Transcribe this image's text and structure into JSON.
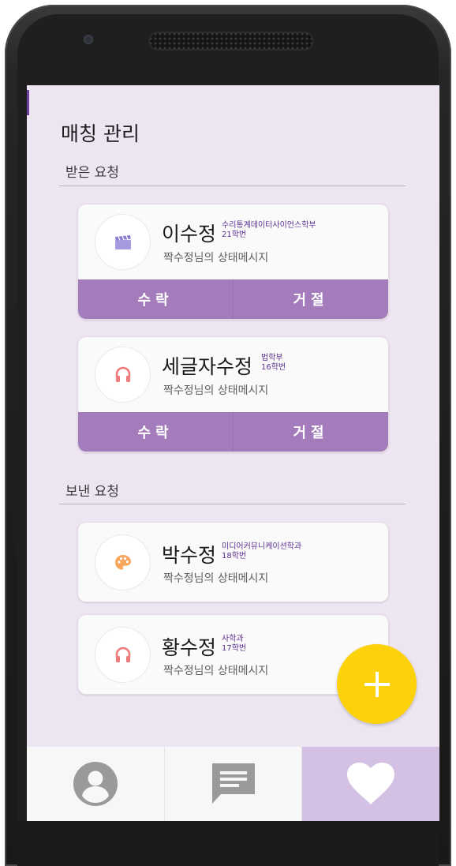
{
  "header": {
    "title": "매칭 관리"
  },
  "received": {
    "label": "받은 요청",
    "cards": [
      {
        "name": "이수정",
        "dept": "수리통계데이터사이언스학부",
        "year": "21학번",
        "status": "짝수정님의 상태메시지",
        "icon": "clapperboard-icon",
        "icon_color": "#9b8fd6",
        "accept": "수락",
        "reject": "거절"
      },
      {
        "name": "세글자수정",
        "dept": "법학부",
        "year": "16학번",
        "status": "짝수정님의 상태메시지",
        "icon": "headphones-icon",
        "icon_color": "#f07b7b",
        "accept": "수락",
        "reject": "거절"
      }
    ]
  },
  "sent": {
    "label": "보낸 요청",
    "cards": [
      {
        "name": "박수정",
        "dept": "미디어커뮤니케이션학과",
        "year": "18학번",
        "status": "짝수정님의 상태메시지",
        "icon": "palette-icon",
        "icon_color": "#f7a65c"
      },
      {
        "name": "황수정",
        "dept": "사학과",
        "year": "17학번",
        "status": "짝수정님의 상태메시지",
        "icon": "headphones-icon",
        "icon_color": "#f07b7b"
      }
    ]
  },
  "fab": {
    "icon": "plus-icon",
    "color": "#fdd20a"
  },
  "nav": {
    "items": [
      {
        "icon": "profile-icon",
        "active": false
      },
      {
        "icon": "chat-icon",
        "active": false
      },
      {
        "icon": "heart-icon",
        "active": true
      }
    ]
  },
  "colors": {
    "accent": "#a47cbc",
    "background": "#ede6f2",
    "meta_text": "#5b2f90"
  }
}
